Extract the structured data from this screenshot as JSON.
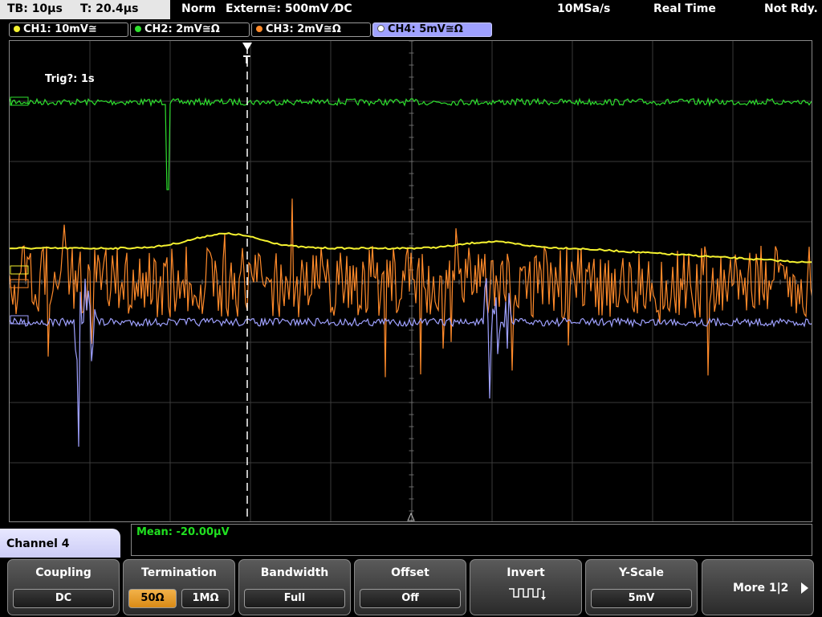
{
  "status": {
    "timebase": "TB: 10µs",
    "trigger_time": "T: 20.4µs",
    "mode": "Norm",
    "trigger_source": "Extern≅: 500mV ⁄DC",
    "sample_rate": "10MSa/s",
    "acquisition": "Real Time",
    "state": "Not Rdy."
  },
  "channels": [
    {
      "label": "CH1: 10mV≅",
      "color": "#f5f230"
    },
    {
      "label": "CH2: 2mV≅Ω",
      "color": "#2ee02e"
    },
    {
      "label": "CH3: 2mV≅Ω",
      "color": "#ff8a2a"
    },
    {
      "label": "CH4: 5mV≅Ω",
      "color": "#9fa1ff"
    }
  ],
  "screen": {
    "trig_note": "Trig?: 1s"
  },
  "measurement": {
    "mean": "Mean: -20.00µV"
  },
  "menu": {
    "title": "Channel 4",
    "coupling_label": "Coupling",
    "coupling_value": "DC",
    "termination_label": "Termination",
    "termination_50": "50Ω",
    "termination_1m": "1MΩ",
    "bandwidth_label": "Bandwidth",
    "bandwidth_value": "Full",
    "offset_label": "Offset",
    "offset_value": "Off",
    "invert_label": "Invert",
    "yscale_label": "Y-Scale",
    "yscale_value": "5mV",
    "more_label": "More 1|2"
  }
}
